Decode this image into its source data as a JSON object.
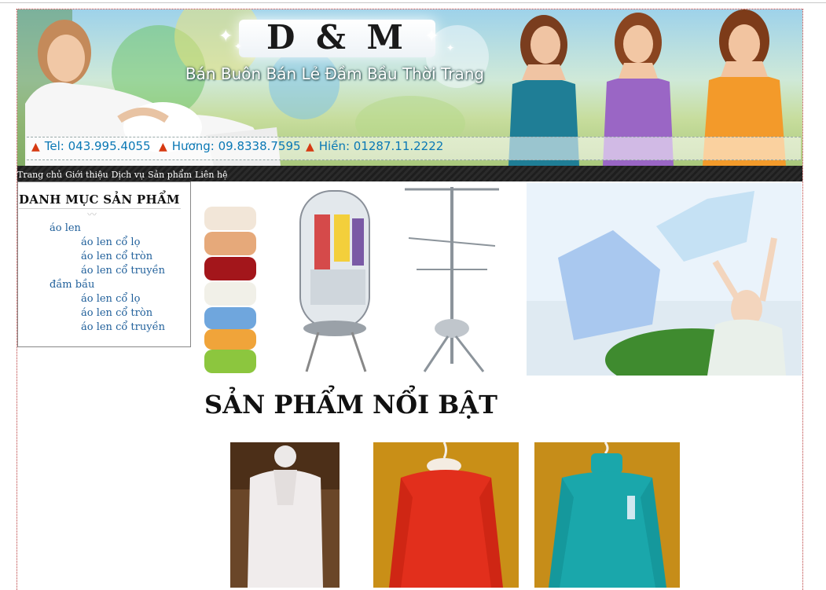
{
  "header": {
    "logo": "D & M",
    "tagline": "Bán Buôn Bán Lẻ Đầm Bầu Thời Trang",
    "contacts": [
      "Tel: 043.995.4055",
      "Hương: 09.8338.7595",
      "Hiền: 01287.11.2222"
    ]
  },
  "nav": {
    "items": [
      "Trang chủ",
      "Giới thiệu",
      "Dịch vụ",
      "Sản phẩm",
      "Liên hệ"
    ]
  },
  "sidebar": {
    "title": "DANH MỤC SẢN PHẨM",
    "categories": [
      {
        "label": "áo len",
        "children": [
          "áo len cổ lọ",
          "áo len cổ tròn",
          "áo len cổ truyền"
        ]
      },
      {
        "label": "đầm bầu",
        "children": [
          "áo len cổ lọ",
          "áo len cổ tròn",
          "áo len cổ truyền"
        ]
      }
    ]
  },
  "main": {
    "featured_title": "SẢN PHẨM NỔI BẬT",
    "products": [
      {
        "image": "white-sleeveless-knit-top",
        "color": "#e9e6e6"
      },
      {
        "image": "red-long-sleeve-sweater",
        "color": "#e2321e"
      },
      {
        "image": "teal-turtleneck-sweater",
        "color": "#1aa7ab"
      }
    ]
  },
  "colors": {
    "link": "#1f5f9a",
    "contact_text": "#0a78b5",
    "navbar": "#232323",
    "page_border": "#b83a3a"
  }
}
